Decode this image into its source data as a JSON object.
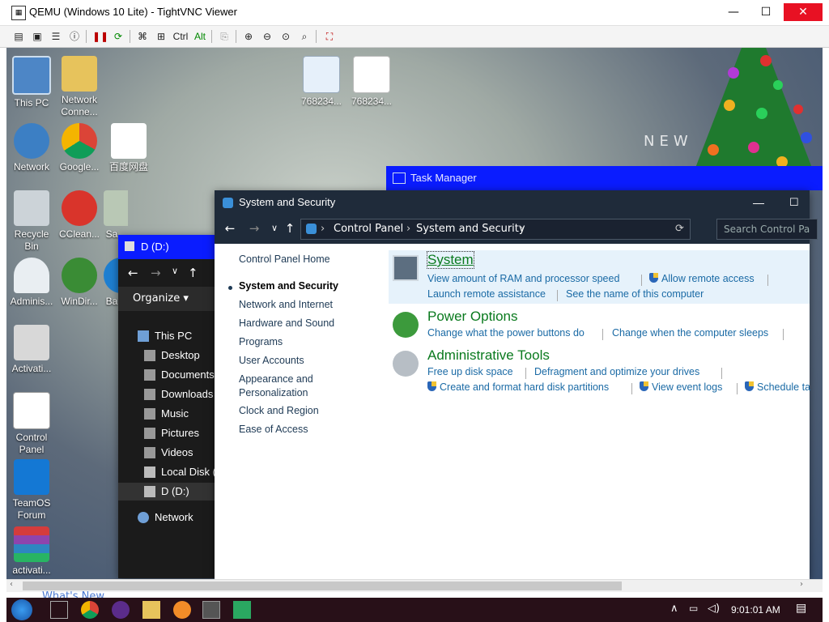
{
  "vnc": {
    "title": "QEMU (Windows 10 Lite) - TightVNC Viewer",
    "minimize": "—",
    "maximize": "☐",
    "close": "✕",
    "toolbar": {
      "ctrl": "Ctrl",
      "alt": "Alt"
    }
  },
  "desktop": {
    "icons": [
      {
        "label": "This PC"
      },
      {
        "label": "Network Conne..."
      },
      {
        "label": "Network"
      },
      {
        "label": "Google..."
      },
      {
        "label": "百度网盘"
      },
      {
        "label": "Recycle Bin"
      },
      {
        "label": "CClean..."
      },
      {
        "label": "Sa..."
      },
      {
        "label": "Adminis..."
      },
      {
        "label": "WinDir..."
      },
      {
        "label": "Ba"
      },
      {
        "label": "Activati..."
      },
      {
        "label": "Control Panel"
      },
      {
        "label": "TeamOS Forum"
      },
      {
        "label": "activati..."
      },
      {
        "label": "768234..."
      },
      {
        "label": "768234..."
      }
    ],
    "wallpaper_text": "NEW"
  },
  "task_manager": {
    "title": "Task Manager"
  },
  "explorer": {
    "title": "D (D:)",
    "organize": "Organize ▾",
    "nav": [
      {
        "label": "This PC"
      },
      {
        "label": "Desktop"
      },
      {
        "label": "Documents"
      },
      {
        "label": "Downloads"
      },
      {
        "label": "Music"
      },
      {
        "label": "Pictures"
      },
      {
        "label": "Videos"
      },
      {
        "label": "Local Disk ("
      },
      {
        "label": "D (D:)"
      },
      {
        "label": "Network"
      }
    ]
  },
  "control_panel": {
    "title": "System and Security",
    "breadcrumb": [
      "Control Panel",
      "System and Security"
    ],
    "search_placeholder": "Search Control Pa",
    "left_nav": [
      {
        "label": "Control Panel Home"
      },
      {
        "label": "System and Security"
      },
      {
        "label": "Network and Internet"
      },
      {
        "label": "Hardware and Sound"
      },
      {
        "label": "Programs"
      },
      {
        "label": "User Accounts"
      },
      {
        "label": "Appearance and Personalization"
      },
      {
        "label": "Clock and Region"
      },
      {
        "label": "Ease of Access"
      }
    ],
    "sections": [
      {
        "heading": "System",
        "links": [
          "View amount of RAM and processor speed",
          "Allow remote access",
          "Launch remote assistance",
          "See the name of this computer"
        ]
      },
      {
        "heading": "Power Options",
        "links": [
          "Change what the power buttons do",
          "Change when the computer sleeps"
        ]
      },
      {
        "heading": "Administrative Tools",
        "links": [
          "Free up disk space",
          "Defragment and optimize your drives",
          "Create and format hard disk partitions",
          "View event logs",
          "Schedule ta"
        ]
      }
    ]
  },
  "taskbar": {
    "whats_new": "What's New",
    "clock": "9:01:01 AM"
  }
}
